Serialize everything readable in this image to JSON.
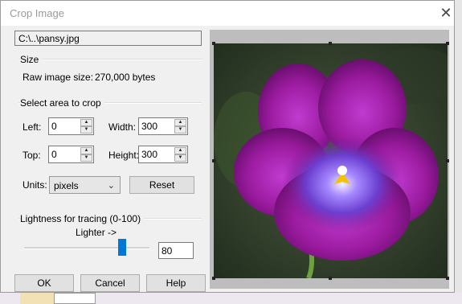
{
  "dialog": {
    "title": "Crop Image",
    "close_glyph": "✕",
    "file_path": "C:\\..\\pansy.jpg"
  },
  "size": {
    "group_label": "Size",
    "raw_label": "Raw image size:",
    "raw_value": "270,000 bytes"
  },
  "crop": {
    "group_label": "Select area to crop",
    "left_label": "Left:",
    "left_value": "0",
    "width_label": "Width:",
    "width_value": "300",
    "top_label": "Top:",
    "top_value": "0",
    "height_label": "Height:",
    "height_value": "300",
    "units_label": "Units:",
    "units_value": "pixels",
    "reset_label": "Reset"
  },
  "lightness": {
    "group_label": "Lightness for tracing (0-100)",
    "lighter_label": "Lighter ->",
    "value": "80",
    "slider_fraction": 0.8
  },
  "buttons": {
    "ok": "OK",
    "cancel": "Cancel",
    "help": "Help"
  },
  "icons": {
    "close": "close-icon",
    "spin_up": "arrow-up-icon",
    "spin_down": "arrow-down-icon",
    "dropdown": "chevron-down-icon"
  },
  "colors": {
    "accent": "#0078d7",
    "petal": "#9a1a9e",
    "center": "#6b3fd0"
  }
}
